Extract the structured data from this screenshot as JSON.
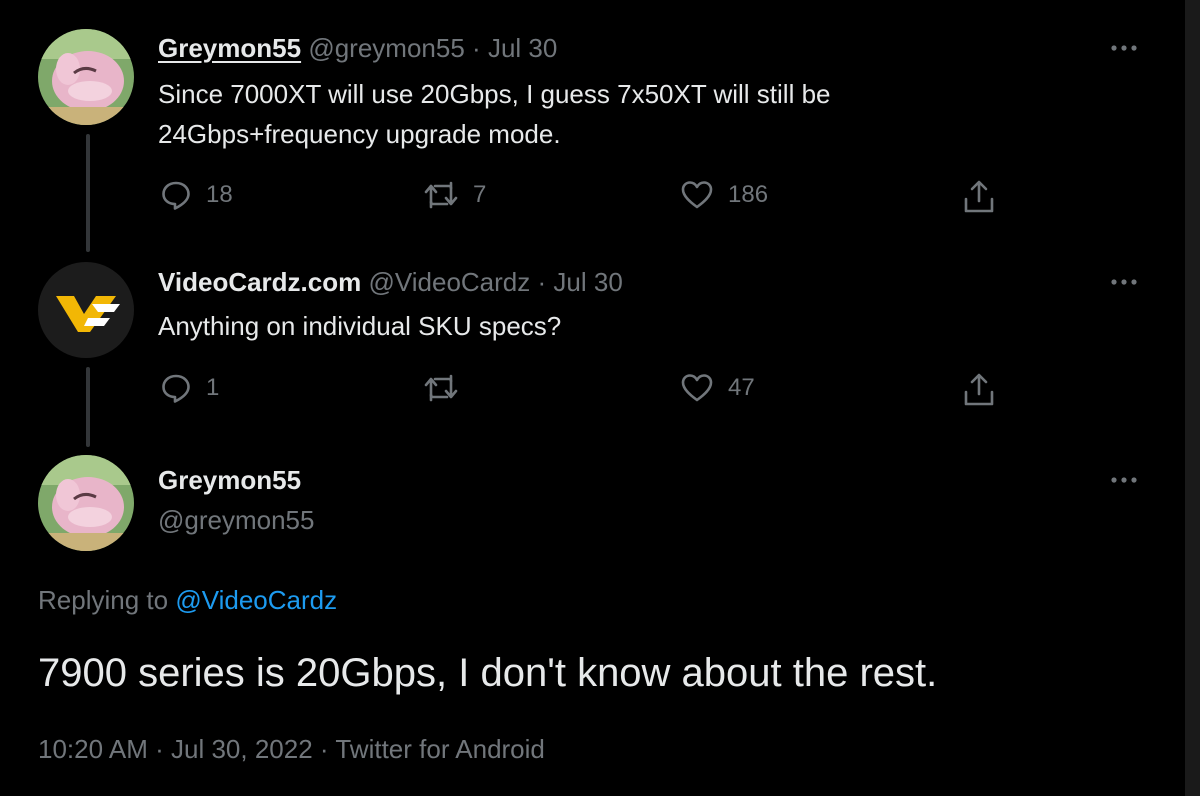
{
  "thread": {
    "tweets": [
      {
        "display_name": "Greymon55",
        "handle": "@greymon55",
        "separator": "·",
        "date": "Jul 30",
        "text_lines": [
          "Since 7000XT will use 20Gbps, I guess 7x50XT will still be",
          "24Gbps+frequency upgrade mode."
        ],
        "replies": "18",
        "retweets": "7",
        "likes": "186",
        "avatar_icon": "pink-creature-avatar"
      },
      {
        "display_name": "VideoCardz.com",
        "handle": "@VideoCardz",
        "separator": "·",
        "date": "Jul 30",
        "text_lines": [
          "Anything on individual SKU specs?"
        ],
        "replies": "1",
        "retweets": "",
        "likes": "47",
        "avatar_icon": "videocardz-logo-avatar"
      }
    ]
  },
  "main_tweet": {
    "display_name": "Greymon55",
    "handle": "@greymon55",
    "replying_prefix": "Replying to",
    "replying_to": "@VideoCardz",
    "text": "7900 series is 20Gbps, I don't know about the rest.",
    "time": "10:20 AM",
    "sep1": "·",
    "date": "Jul 30, 2022",
    "sep2": "·",
    "source": "Twitter for Android"
  },
  "icons": {
    "more": "more-dots-icon",
    "reply": "reply-icon",
    "retweet": "retweet-icon",
    "like": "heart-icon",
    "share": "share-icon"
  },
  "colors": {
    "background": "#000000",
    "text": "#e7e9ea",
    "muted": "#71767b",
    "link": "#1d9bf0",
    "thread_line": "#333639"
  }
}
